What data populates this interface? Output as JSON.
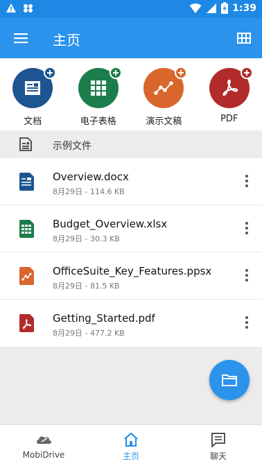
{
  "status_bar": {
    "time": "1:39",
    "left_icons": [
      "warning-icon",
      "app-notification-icon"
    ],
    "right_icons": [
      "wifi-icon",
      "cellular-icon",
      "battery-charging-icon"
    ]
  },
  "app_bar": {
    "title": "主页",
    "menu_icon": "menu-icon",
    "view_icon": "grid-view-icon",
    "color": "#2b93ec"
  },
  "quick_create": [
    {
      "label": "文档",
      "icon": "document-icon",
      "color": "#1d5592"
    },
    {
      "label": "电子表格",
      "icon": "spreadsheet-icon",
      "color": "#1b7d4b"
    },
    {
      "label": "演示文稿",
      "icon": "presentation-icon",
      "color": "#d9662c"
    },
    {
      "label": "PDF",
      "icon": "pdf-icon",
      "color": "#b12b2b"
    }
  ],
  "section": {
    "title": "示例文件",
    "icon": "file-icon"
  },
  "files": [
    {
      "name": "Overview.docx",
      "meta": "8月29日 - 114.6 KB",
      "type": "doc",
      "color": "#1d5592"
    },
    {
      "name": "Budget_Overview.xlsx",
      "meta": "8月29日 - 30.3 KB",
      "type": "xls",
      "color": "#1b7d4b"
    },
    {
      "name": "OfficeSuite_Key_Features.ppsx",
      "meta": "8月29日 - 81.5 KB",
      "type": "ppt",
      "color": "#d9662c"
    },
    {
      "name": "Getting_Started.pdf",
      "meta": "8月29日 - 477.2 KB",
      "type": "pdf",
      "color": "#b12b2b"
    }
  ],
  "fab": {
    "icon": "folder-icon"
  },
  "bottom_nav": [
    {
      "label": "MobiDrive",
      "icon": "cloud-icon",
      "active": false
    },
    {
      "label": "主页",
      "icon": "home-icon",
      "active": true
    },
    {
      "label": "聊天",
      "icon": "chat-icon",
      "active": false
    }
  ]
}
